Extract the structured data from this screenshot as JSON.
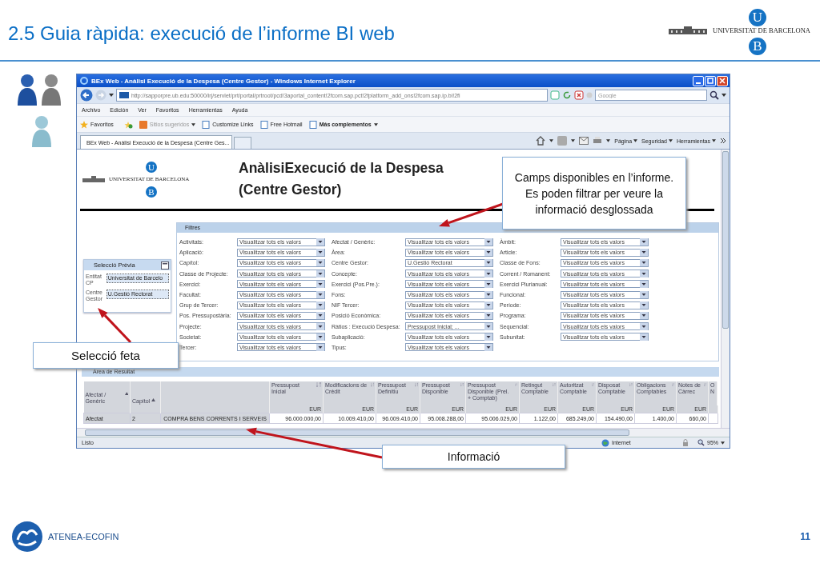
{
  "slide": {
    "title": "2.5 Guia ràpida: execució de l’informe BI web",
    "logo": {
      "letter_top": "U",
      "letter_bottom": "B",
      "name": "UNIVERSITAT DE BARCELONA"
    },
    "brand": "ATENEA-ECOFIN",
    "page": "11"
  },
  "browser": {
    "title": "BEx Web - Anàlisi Execució de la Despesa (Centre Gestor) - Windows Internet Explorer",
    "address": "http://sapporpre.ub.edu:50000/irj/servlet/prt/portal/prtroot/pcd!3aportal_content!2fcom.sap.pct!2fplatform_add_ons!2fcom.sap.ip.bi!2fi",
    "search": {
      "placeholder": "Google"
    },
    "menu": [
      "Archivo",
      "Edición",
      "Ver",
      "Favoritos",
      "Herramientas",
      "Ayuda"
    ],
    "favorites": [
      {
        "label": "Favoritos",
        "kind": "star"
      },
      {
        "label": "Sitios sugeridos",
        "kind": "suggested"
      },
      {
        "label": "Customize Links",
        "kind": "link"
      },
      {
        "label": "Free Hotmail",
        "kind": "link"
      },
      {
        "label": "Más complementos",
        "kind": "addons"
      }
    ],
    "tab": {
      "label": "BEx Web - Anàlisi Execució de la Despesa (Centre Ges..."
    },
    "command_bar": [
      "Página",
      "Seguridad",
      "Herramientas"
    ],
    "status": {
      "text": "Listo",
      "zone": "Internet",
      "zoom": "95%"
    }
  },
  "page": {
    "logo": {
      "name": "UNIVERSITAT DE BARCELONA",
      "letter_top": "U",
      "letter_bottom": "B"
    },
    "title_lines": [
      "AnàlisiExecució de la Despesa",
      "(Centre Gestor)"
    ],
    "preselection": {
      "title": "Selecció Prèvia",
      "fields": [
        {
          "label": "Entitat CP",
          "value": "Universitat de Barcelo"
        },
        {
          "label": "Centre Gestor",
          "value": "U.Gestió Rectorat"
        }
      ]
    },
    "filters": {
      "title": "Filtres",
      "columns": [
        [
          {
            "label": "Activitats:",
            "value": "Visualitzar tots els valors"
          },
          {
            "label": "Aplicació:",
            "value": "Visualitzar tots els valors"
          },
          {
            "label": "Capítol:",
            "value": "Visualitzar tots els valors"
          },
          {
            "label": "Classe de Projecte:",
            "value": "Visualitzar tots els valors"
          },
          {
            "label": "Exercici:",
            "value": "Visualitzar tots els valors"
          },
          {
            "label": "Facultat:",
            "value": "Visualitzar tots els valors"
          },
          {
            "label": "Grup de Tercer:",
            "value": "Visualitzar tots els valors"
          },
          {
            "label": "Pos. Pressupostària:",
            "value": "Visualitzar tots els valors"
          },
          {
            "label": "Projecte:",
            "value": "Visualitzar tots els valors"
          },
          {
            "label": "Societat:",
            "value": "Visualitzar tots els valors"
          },
          {
            "label": "Tercer:",
            "value": "Visualitzar tots els valors"
          }
        ],
        [
          {
            "label": "Afectat / Genèric:",
            "value": "Visualitzar tots els valors"
          },
          {
            "label": "Àrea:",
            "value": "Visualitzar tots els valors"
          },
          {
            "label": "Centre Gestor:",
            "value": "U.Gestió Rectorat"
          },
          {
            "label": "Concepte:",
            "value": "Visualitzar tots els valors"
          },
          {
            "label": "Exercici (Pos.Pre.):",
            "value": "Visualitzar tots els valors"
          },
          {
            "label": "Fons:",
            "value": "Visualitzar tots els valors"
          },
          {
            "label": "NIF Tercer:",
            "value": "Visualitzar tots els valors"
          },
          {
            "label": "Posició Econòmica:",
            "value": "Visualitzar tots els valors"
          },
          {
            "label": "Ràtios : Execució Despesa:",
            "value": "Pressupost Inicial; ..."
          },
          {
            "label": "Subaplicació:",
            "value": "Visualitzar tots els valors"
          },
          {
            "label": "Tipus:",
            "value": "Visualitzar tots els valors"
          }
        ],
        [
          {
            "label": "Àmbit:",
            "value": "Visualitzar tots els valors"
          },
          {
            "label": "Article:",
            "value": "Visualitzar tots els valors"
          },
          {
            "label": "Classe de Fons:",
            "value": "Visualitzar tots els valors"
          },
          {
            "label": "Corrent / Romanent:",
            "value": "Visualitzar tots els valors"
          },
          {
            "label": "Exercici Plurianual:",
            "value": "Visualitzar tots els valors"
          },
          {
            "label": "Funcional:",
            "value": "Visualitzar tots els valors"
          },
          {
            "label": "Període:",
            "value": "Visualitzar tots els valors"
          },
          {
            "label": "Programa:",
            "value": "Visualitzar tots els valors"
          },
          {
            "label": "Sequencial:",
            "value": "Visualitzar tots els valors"
          },
          {
            "label": "Subunitat:",
            "value": "Visualitzar tots els valors"
          }
        ]
      ]
    },
    "results": {
      "title": "Àrea de Resultat",
      "columns": [
        {
          "label": "Afectat / Genèric",
          "kind": "key"
        },
        {
          "label": "Capítol",
          "kind": "key"
        },
        {
          "kind": "text"
        },
        {
          "label": "Pressupost Inicial",
          "kind": "amount",
          "unit": "EUR"
        },
        {
          "label": "Modificacions de Crèdit",
          "kind": "amount",
          "unit": "EUR"
        },
        {
          "label": "Pressupost Definitiu",
          "kind": "amount",
          "unit": "EUR"
        },
        {
          "label": "Pressupost Disponible",
          "kind": "amount",
          "unit": "EUR"
        },
        {
          "label": "Pressupost Disponible (Prel. + Comptab)",
          "kind": "amount",
          "unit": "EUR"
        },
        {
          "label": "Retingut Comptable",
          "kind": "amount",
          "unit": "EUR"
        },
        {
          "label": "Autoritzat Comptable",
          "kind": "amount",
          "unit": "EUR"
        },
        {
          "label": "Disposat Comptable",
          "kind": "amount",
          "unit": "EUR"
        },
        {
          "label": "Obligacions Comptables",
          "kind": "amount",
          "unit": "EUR"
        },
        {
          "label": "Notes de Càrrec",
          "kind": "amount",
          "unit": "EUR"
        },
        {
          "label": "O N",
          "kind": "cut"
        }
      ],
      "rows": [
        [
          "Afectat",
          "2",
          "COMPRA BENS CORRENTS I SERVEIS",
          "96.000.000,00",
          "10.009.410,00",
          "96.009.410,00",
          "95.008.288,00",
          "95.006.029,00",
          "1.122,00",
          "685.249,00",
          "154.490,00",
          "1.400,00",
          "660,00"
        ]
      ]
    }
  },
  "callouts": [
    {
      "text": "Camps disponibles en l’informe. Es poden filtrar per veure la informació desglossada"
    },
    {
      "text": "Selecció feta"
    },
    {
      "text": "Informació"
    }
  ]
}
